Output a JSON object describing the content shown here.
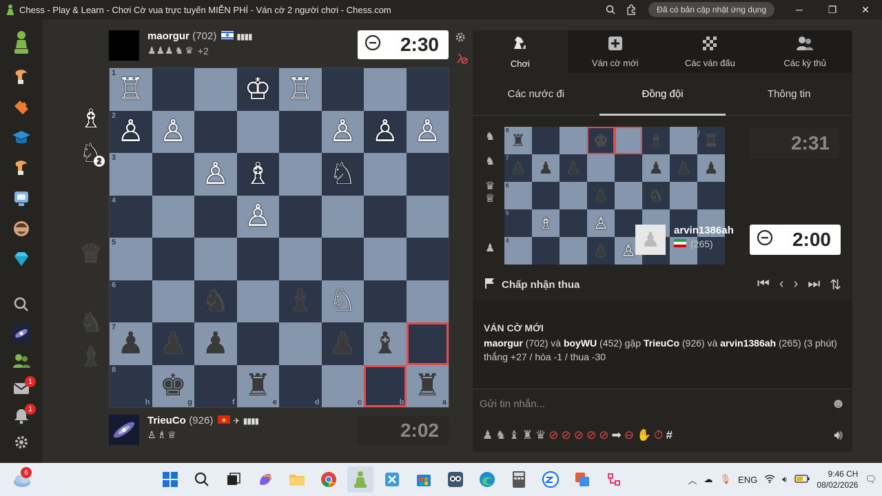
{
  "window": {
    "title": "Chess - Play & Learn - Chơi Cờ vua trực tuyến MIỄN PHÍ - Ván cờ 2 người chơi - Chess.com",
    "update_pill": "Đã có bản cập nhật ứng dụng"
  },
  "sidebar": {
    "items": [
      "logo",
      "play",
      "puzzles",
      "learn",
      "watch",
      "computer",
      "coach",
      "premium",
      "search",
      "news",
      "friends",
      "messages",
      "notifications",
      "settings"
    ],
    "message_badge": "1",
    "notification_badge": "1"
  },
  "top_player": {
    "name": "maorgur",
    "rating": "(702)",
    "captured_suffix": "+2",
    "clock": "2:30"
  },
  "bottom_player": {
    "name": "TrieuCo",
    "rating": "(926)",
    "clock": "2:02"
  },
  "board": {
    "ranks": [
      "1",
      "2",
      "3",
      "4",
      "5",
      "6",
      "7",
      "8"
    ],
    "files": [
      "h",
      "g",
      "f",
      "e",
      "d",
      "c",
      "b",
      "a"
    ],
    "rows": [
      [
        "wR",
        "",
        "",
        "wK",
        "wR",
        "",
        "",
        ""
      ],
      [
        "wP",
        "wP",
        "",
        "",
        "",
        "wP",
        "wP",
        "wP"
      ],
      [
        "",
        "",
        "wP",
        "wB",
        "",
        "wN",
        "",
        ""
      ],
      [
        "",
        "",
        "",
        "wP",
        "",
        "",
        "",
        ""
      ],
      [
        "",
        "",
        "",
        "",
        "",
        "",
        "",
        ""
      ],
      [
        "",
        "",
        "bN",
        "",
        "bB",
        "wN",
        "",
        ""
      ],
      [
        "bP",
        "bP",
        "bP",
        "",
        "",
        "bP",
        "bB",
        ""
      ],
      [
        "",
        "bK",
        "",
        "bR",
        "",
        "",
        "",
        "bR"
      ]
    ],
    "highlights": [
      "6-7",
      "7-6"
    ]
  },
  "pocket": {
    "white": [
      "wB",
      "wN"
    ],
    "white_knight_count": "2",
    "black": [
      "bQ",
      "bN",
      "bB"
    ]
  },
  "panel": {
    "tabs": [
      {
        "label": "Chơi",
        "icon": "play-icon"
      },
      {
        "label": "Ván cờ mới",
        "icon": "plus-icon"
      },
      {
        "label": "Các ván đấu",
        "icon": "board-icon"
      },
      {
        "label": "Các kỳ thủ",
        "icon": "players-icon"
      }
    ],
    "subtabs": [
      "Các nước đi",
      "Đồng đội",
      "Thông tin"
    ],
    "partner_board": {
      "rows": [
        [
          "bR",
          "",
          "",
          "bK",
          "",
          "bB",
          "",
          "bR"
        ],
        [
          "bP",
          "bP",
          "bP",
          "",
          "",
          "bP",
          "bP",
          "bP"
        ],
        [
          "",
          "",
          "",
          "bP",
          "",
          "bN",
          "",
          ""
        ],
        [
          "",
          "wB",
          "",
          "wP",
          "",
          "",
          "",
          ""
        ],
        [
          "",
          "",
          "",
          "bP",
          "wP",
          "",
          "",
          ""
        ]
      ],
      "ranks": [
        "8",
        "7",
        "6",
        "5",
        "4"
      ],
      "ghost_name": "boyW",
      "clock_inactive": "2:31",
      "partner_name": "arvin1386ah",
      "partner_rating": "(265)",
      "partner_clock": "2:00"
    },
    "resign_label": "Chấp nhận thua",
    "info": {
      "title": "VÁN CỜ MỚI",
      "p1": "maorgur",
      "p1r": "(702) và",
      "p2": "boyWU",
      "p2r": "(452) gặp",
      "p3": "TrieuCo",
      "p3r": "(926) và",
      "p4": "arvin1386ah",
      "p4r": "(265) (3 phút)",
      "result": "thắng +27 / hòa -1 / thua -30"
    },
    "chat_placeholder": "Gửi tin nhắn..."
  },
  "taskbar": {
    "weather_badge": "6",
    "lang": "ENG",
    "time": "9:46 CH",
    "date": "08/02/2026"
  }
}
